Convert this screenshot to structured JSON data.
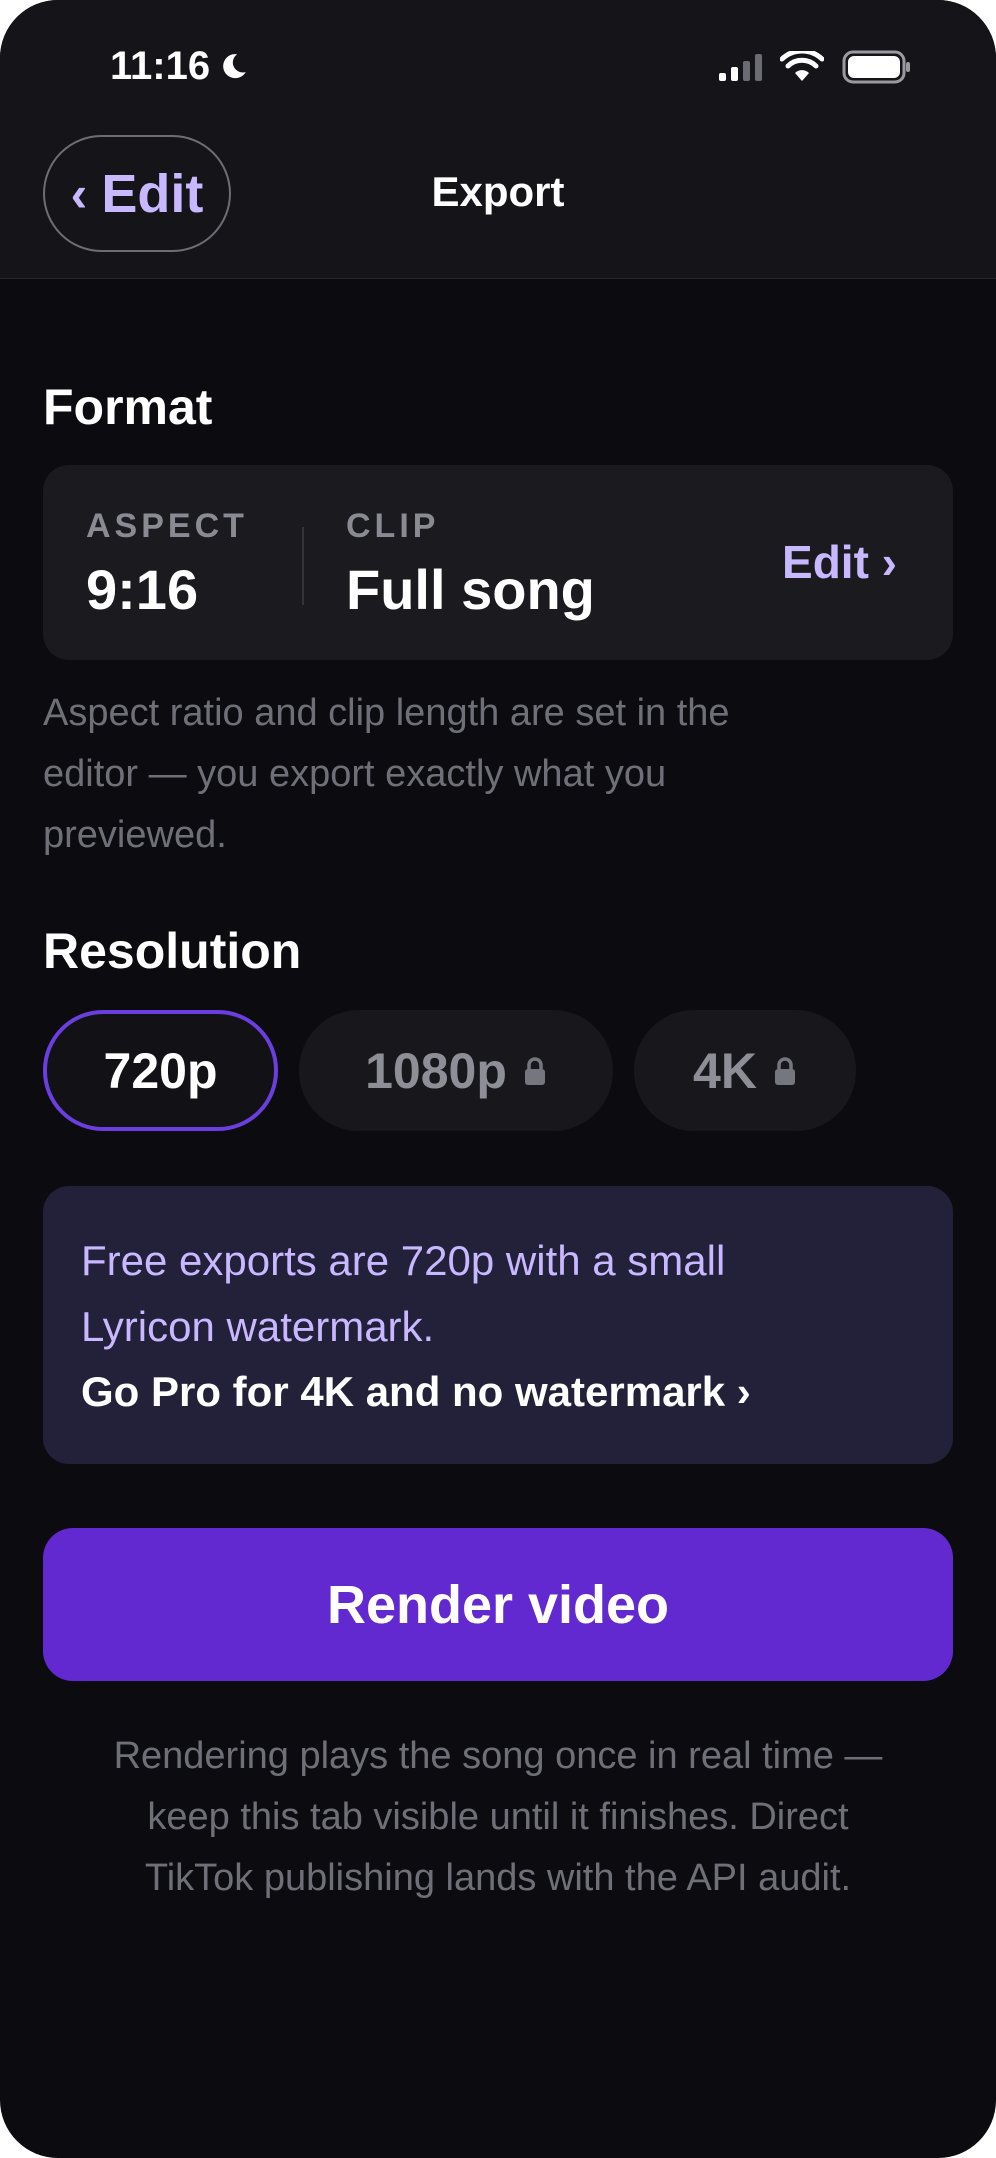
{
  "status_bar": {
    "time": "11:16",
    "icons": [
      "moon-icon",
      "cellular-signal-icon",
      "wifi-icon",
      "battery-icon"
    ]
  },
  "header": {
    "back_label": "Edit",
    "back_chevron": "‹",
    "title": "Export"
  },
  "format": {
    "section_title": "Format",
    "aspect_label": "ASPECT",
    "aspect_value": "9:16",
    "clip_label": "CLIP",
    "clip_value": "Full song",
    "edit_label": "Edit ›",
    "helper_lines": [
      "Aspect ratio and clip length are set in the",
      "editor — you export exactly what you",
      "previewed."
    ]
  },
  "resolution": {
    "section_title": "Resolution",
    "options": [
      {
        "label": "720p",
        "selected": true,
        "locked": false
      },
      {
        "label": "1080p",
        "selected": false,
        "locked": true
      },
      {
        "label": "4K",
        "selected": false,
        "locked": true
      }
    ]
  },
  "promo": {
    "text_lines": [
      "Free exports are 720p with a small",
      "Lyricon watermark."
    ],
    "cta": "Go Pro for 4K and no watermark ›"
  },
  "render_button": "Render video",
  "footer_lines": [
    "Rendering plays the song once in real time —",
    "keep this tab visible until it finishes. Direct",
    "TikTok publishing lands with the API audit."
  ],
  "colors": {
    "background": "#0c0c10",
    "accent": "#6329d0",
    "accent_text": "#c8b8ff",
    "selected_border": "#6b3ee0",
    "promo_bg": "#23203a"
  }
}
